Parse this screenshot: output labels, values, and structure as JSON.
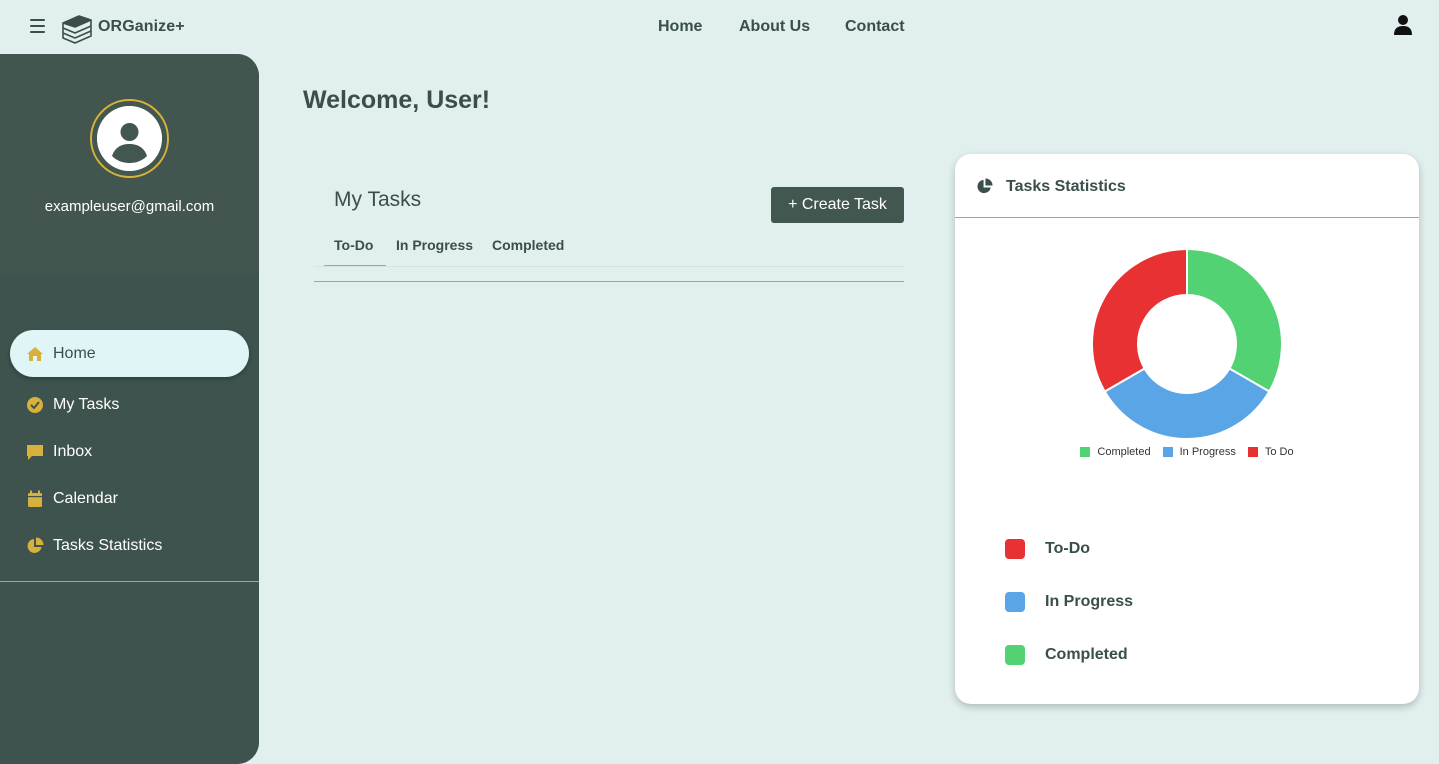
{
  "header": {
    "brand": "ORGanize+",
    "nav": [
      "Home",
      "About Us",
      "Contact"
    ]
  },
  "sidebar": {
    "email": "exampleuser@gmail.com",
    "items": [
      {
        "label": "Home",
        "icon": "home-icon",
        "active": true
      },
      {
        "label": "My Tasks",
        "icon": "check-circle-icon",
        "active": false
      },
      {
        "label": "Inbox",
        "icon": "message-icon",
        "active": false
      },
      {
        "label": "Calendar",
        "icon": "calendar-icon",
        "active": false
      },
      {
        "label": "Tasks Statistics",
        "icon": "pie-chart-icon",
        "active": false
      }
    ]
  },
  "main": {
    "welcome": "Welcome, User!",
    "tasks_title": "My Tasks",
    "create_button": "+ Create Task",
    "tabs": [
      "To-Do",
      "In Progress",
      "Completed"
    ],
    "active_tab": "To-Do"
  },
  "stats": {
    "title": "Tasks Statistics",
    "mini_legend": [
      "Completed",
      "In Progress",
      "To Do"
    ],
    "legend": [
      "To-Do",
      "In Progress",
      "Completed"
    ]
  },
  "colors": {
    "accent": "#c9a43c",
    "sidebar": "#41574f",
    "completed": "#52d273",
    "in_progress": "#5aa5e6",
    "todo": "#e83132"
  },
  "chart_data": {
    "type": "pie",
    "categories": [
      "Completed",
      "In Progress",
      "To Do"
    ],
    "values": [
      1,
      1,
      1
    ],
    "colors": [
      "#52d273",
      "#5aa5e6",
      "#e83132"
    ],
    "legend_position": "bottom"
  }
}
